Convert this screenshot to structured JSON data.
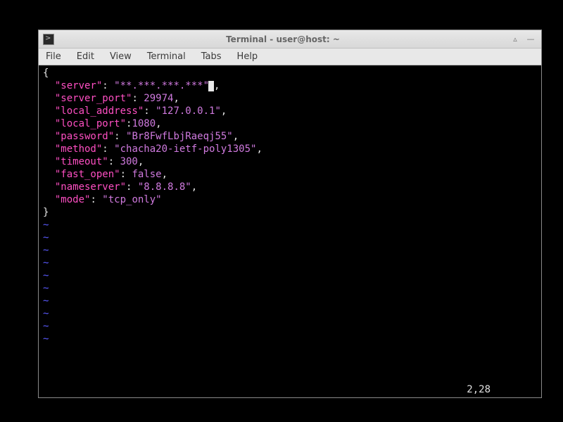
{
  "window": {
    "title": "Terminal - user@host: ~"
  },
  "menu": {
    "items": [
      "File",
      "Edit",
      "View",
      "Terminal",
      "Tabs",
      "Help"
    ]
  },
  "json_config": {
    "indent": "  ",
    "entries": [
      {
        "key": "server",
        "value": "**.***.***.***",
        "type": "str",
        "cursor_after": true
      },
      {
        "key": "server_port",
        "value": "29974",
        "type": "num"
      },
      {
        "key": "local_address",
        "value": "127.0.0.1",
        "type": "str"
      },
      {
        "key": "local_port",
        "value": "1080",
        "type": "num",
        "tight_colon": true
      },
      {
        "key": "password",
        "value": "Br8FwfLbjRaeqj55",
        "type": "str"
      },
      {
        "key": "method",
        "value": "chacha20-ietf-poly1305",
        "type": "str"
      },
      {
        "key": "timeout",
        "value": "300",
        "type": "num"
      },
      {
        "key": "fast_open",
        "value": "false",
        "type": "bool"
      },
      {
        "key": "nameserver",
        "value": "8.8.8.8",
        "type": "str"
      },
      {
        "key": "mode",
        "value": "tcp_only",
        "type": "str",
        "last": true
      }
    ]
  },
  "tilde_rows": 10,
  "status": {
    "pos": "2,28"
  }
}
